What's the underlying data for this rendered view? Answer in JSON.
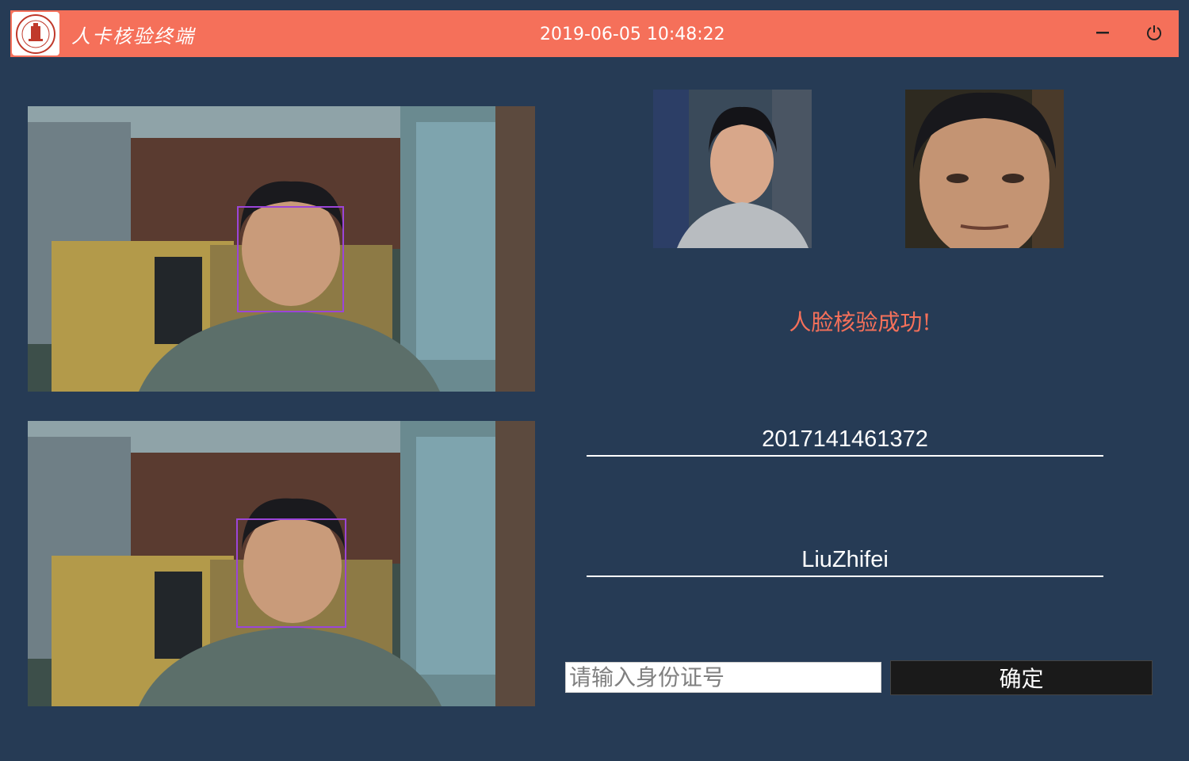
{
  "titlebar": {
    "app_title": "人卡核验终端",
    "datetime": "2019-06-05 10:48:22",
    "minimize_icon": "minus-icon",
    "power_icon": "power-icon",
    "color": "#f5705a"
  },
  "camera": {
    "feeds": [
      "live-camera-feed",
      "captured-frame"
    ],
    "face_box_color": "#9b45d8"
  },
  "photos": {
    "id_card_photo": "id-card-face-photo",
    "captured_photo": "captured-face-photo"
  },
  "result": {
    "status_text": "人脸核验成功!",
    "id_number": "2017141461372",
    "name": "LiuZhifei"
  },
  "form": {
    "input_placeholder": "请输入身份证号",
    "input_value": "",
    "confirm_label": "确定"
  },
  "colors": {
    "background": "#263b55",
    "accent": "#f5705a"
  }
}
